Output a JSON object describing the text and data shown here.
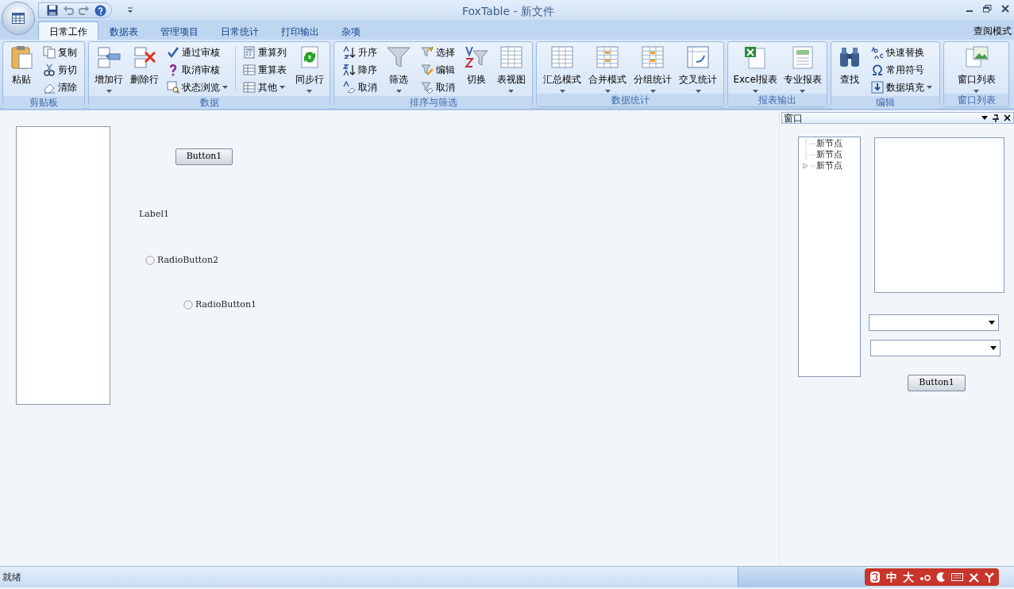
{
  "title_bar": {
    "title": "FoxTable - 新文件"
  },
  "tabs": [
    {
      "label": "日常工作",
      "selected": true
    },
    {
      "label": "数据表",
      "selected": false
    },
    {
      "label": "管理项目",
      "selected": false
    },
    {
      "label": "日常统计",
      "selected": false
    },
    {
      "label": "打印输出",
      "selected": false
    },
    {
      "label": "杂项",
      "selected": false
    }
  ],
  "mode_label": "查阅模式",
  "ribbon": [
    {
      "title": "剪贴板",
      "items": [
        {
          "kind": "large",
          "label": "粘贴",
          "dropdown": false
        },
        {
          "kind": "stack",
          "items": [
            {
              "label": "复制",
              "dropdown": false
            },
            {
              "label": "剪切",
              "dropdown": false
            },
            {
              "label": "清除",
              "dropdown": false
            }
          ]
        }
      ]
    },
    {
      "title": "数据",
      "items": [
        {
          "kind": "large",
          "label": "增加行",
          "dropdown": true
        },
        {
          "kind": "large",
          "label": "删除行",
          "dropdown": false
        },
        {
          "kind": "stack",
          "items": [
            {
              "label": "通过审核",
              "dropdown": false
            },
            {
              "label": "取消审核",
              "dropdown": false
            },
            {
              "label": "状态浏览",
              "dropdown": true
            }
          ]
        },
        {
          "kind": "stack",
          "items": [
            {
              "label": "重算列",
              "dropdown": false
            },
            {
              "label": "重算表",
              "dropdown": false
            },
            {
              "label": "其他",
              "dropdown": true
            }
          ]
        },
        {
          "kind": "large",
          "label": "同步行",
          "dropdown": true
        }
      ]
    },
    {
      "title": "排序与筛选",
      "items": [
        {
          "kind": "stack",
          "items": [
            {
              "label": "升序",
              "dropdown": false
            },
            {
              "label": "降序",
              "dropdown": false
            },
            {
              "label": "取消",
              "dropdown": false
            }
          ]
        },
        {
          "kind": "large",
          "label": "筛选",
          "dropdown": true
        },
        {
          "kind": "stack",
          "items": [
            {
              "label": "选择",
              "dropdown": false
            },
            {
              "label": "编辑",
              "dropdown": false
            },
            {
              "label": "取消",
              "dropdown": false
            }
          ]
        },
        {
          "kind": "large",
          "label": "切换",
          "dropdown": false
        },
        {
          "kind": "large",
          "label": "表视图",
          "dropdown": true
        }
      ]
    },
    {
      "title": "数据统计",
      "items": [
        {
          "kind": "large",
          "label": "汇总模式",
          "dropdown": true
        },
        {
          "kind": "large",
          "label": "合并模式",
          "dropdown": true
        },
        {
          "kind": "large",
          "label": "分组统计",
          "dropdown": true
        },
        {
          "kind": "large",
          "label": "交叉统计",
          "dropdown": true
        }
      ]
    },
    {
      "title": "报表输出",
      "items": [
        {
          "kind": "large",
          "label": "Excel报表",
          "dropdown": true
        },
        {
          "kind": "large",
          "label": "专业报表",
          "dropdown": true
        }
      ]
    },
    {
      "title": "编辑",
      "items": [
        {
          "kind": "large",
          "label": "查找",
          "dropdown": false
        },
        {
          "kind": "stack",
          "items": [
            {
              "label": "快速替换",
              "dropdown": false
            },
            {
              "label": "常用符号",
              "dropdown": false
            },
            {
              "label": "数据填充",
              "dropdown": true
            }
          ]
        }
      ]
    },
    {
      "title": "窗口列表",
      "items": [
        {
          "kind": "large",
          "label": "窗口列表",
          "dropdown": true
        }
      ]
    }
  ],
  "designer": {
    "controls": [
      {
        "kind": "listbox"
      },
      {
        "kind": "button",
        "text": "Button1"
      },
      {
        "kind": "label",
        "text": "Label1"
      },
      {
        "kind": "radio",
        "text": "RadioButton2",
        "selected": false
      },
      {
        "kind": "radio",
        "text": "RadioButton1",
        "selected": false
      }
    ]
  },
  "dock_panel": {
    "title": "窗口",
    "controls": [
      {
        "kind": "tree",
        "nodes": [
          {
            "label": "新节点",
            "expandable": false
          },
          {
            "label": "新节点",
            "expandable": false
          },
          {
            "label": "新节点",
            "expandable": true
          }
        ]
      },
      {
        "kind": "listbox"
      },
      {
        "kind": "combo"
      },
      {
        "kind": "combo"
      },
      {
        "kind": "button",
        "text": "Button1"
      }
    ]
  },
  "status_bar": {
    "text": "就绪"
  },
  "ime_bar": {
    "labels": [
      "中",
      "大"
    ]
  }
}
